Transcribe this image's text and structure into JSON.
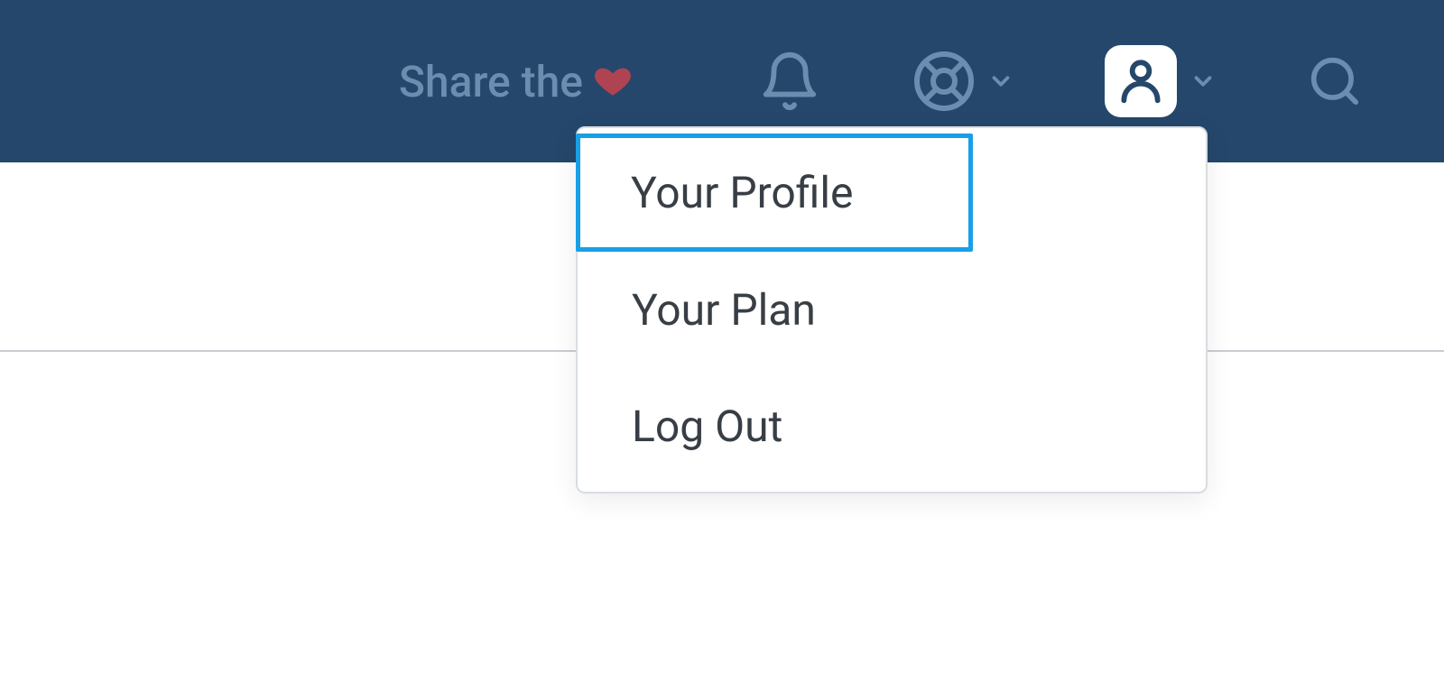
{
  "topbar": {
    "share_label": "Share the",
    "heart_color": "#b04352",
    "icon_color": "#6b8daf",
    "bg_color": "#25476b",
    "profile_active_bg": "#ffffff"
  },
  "dropdown": {
    "items": [
      {
        "label": "Your Profile",
        "highlighted": true
      },
      {
        "label": "Your Plan",
        "highlighted": false
      },
      {
        "label": "Log Out",
        "highlighted": false
      }
    ]
  }
}
